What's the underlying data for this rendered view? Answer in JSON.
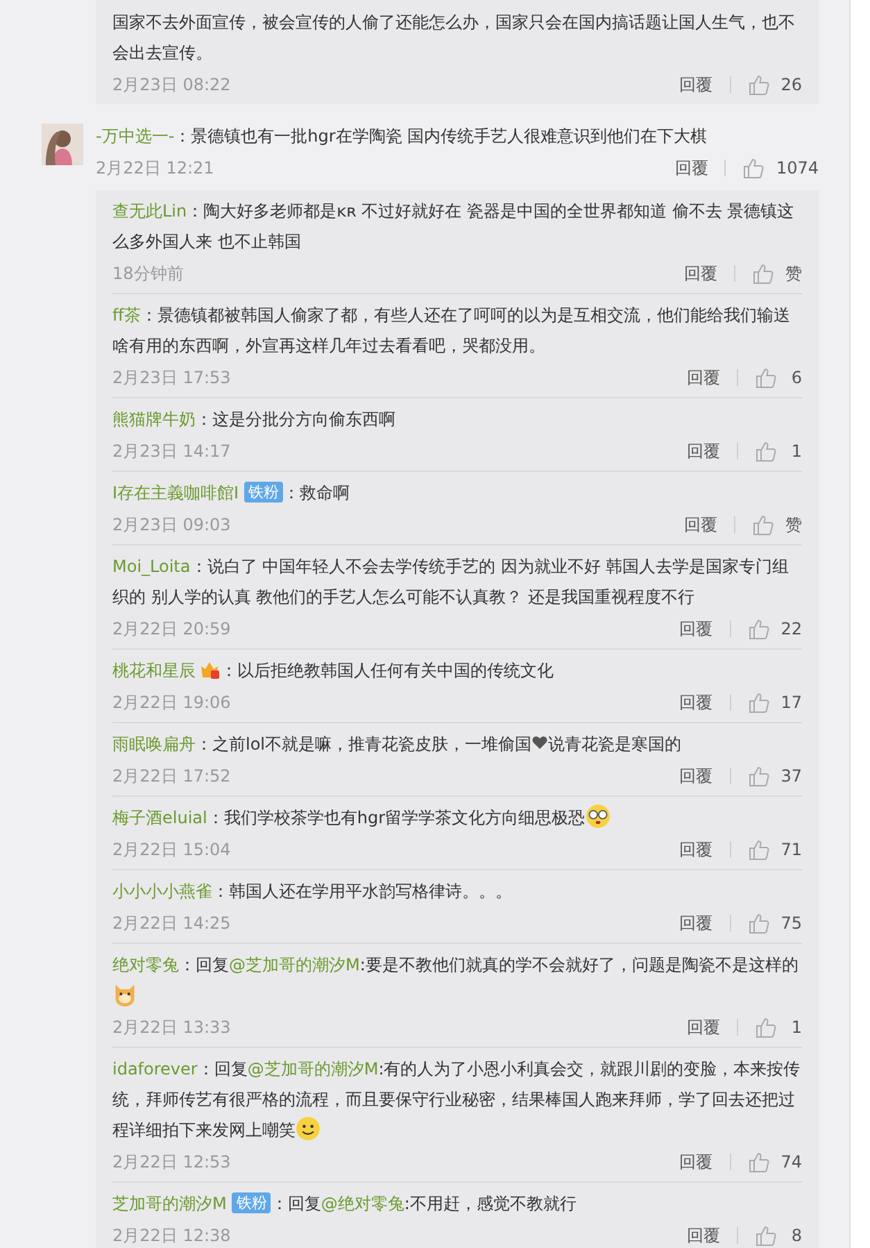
{
  "prev_reply": {
    "parts": [
      {
        "kind": "text",
        "text": "国家不去外面宣传，被会宣传的人偷了还能怎么办，国家只会在国内搞话题让国人生气，也不会出去宣传。"
      }
    ],
    "time": "2月23日 08:22",
    "reply_label": "回覆",
    "likes": "26"
  },
  "comment": {
    "user": "-万中选一-",
    "parts": [
      {
        "kind": "text",
        "text": "：景德镇也有一批hgr在学陶瓷 国内传统手艺人很难意识到他们在下大棋"
      }
    ],
    "time": "2月22日 12:21",
    "reply_label": "回覆",
    "likes": "1074",
    "replies": [
      {
        "user": "查无此Lin",
        "parts": [
          {
            "kind": "text",
            "text": "：陶大好多老师都是ᴋʀ 不过好就好在 瓷器是中国的全世界都知道 偷不去 景德镇这么多外国人来 也不止韩国"
          }
        ],
        "time": "18分钟前",
        "reply_label": "回覆",
        "likes": "赞"
      },
      {
        "user": "ff茶",
        "parts": [
          {
            "kind": "text",
            "text": "：景德镇都被韩国人偷家了都，有些人还在了呵呵的以为是互相交流，他们能给我们输送啥有用的东西啊，外宣再这样几年过去看看吧，哭都没用。"
          }
        ],
        "time": "2月23日 17:53",
        "reply_label": "回覆",
        "likes": "6"
      },
      {
        "user": "熊猫牌牛奶",
        "parts": [
          {
            "kind": "text",
            "text": "：这是分批分方向偷东西啊"
          }
        ],
        "time": "2月23日 14:17",
        "reply_label": "回覆",
        "likes": "1"
      },
      {
        "user": "I存在主義咖啡館I",
        "badge": "铁粉",
        "parts": [
          {
            "kind": "text",
            "text": "：救命啊"
          }
        ],
        "time": "2月23日 09:03",
        "reply_label": "回覆",
        "likes": "赞"
      },
      {
        "user": "Moi_Loita",
        "parts": [
          {
            "kind": "text",
            "text": "：说白了 中国年轻人不会去学传统手艺的 因为就业不好 韩国人去学是国家专门组织的 别人学的认真 教他们的手艺人怎么可能不认真教？ 还是我国重视程度不行"
          }
        ],
        "time": "2月22日 20:59",
        "reply_label": "回覆",
        "likes": "22"
      },
      {
        "user": "桃花和星辰",
        "member_icon": true,
        "parts": [
          {
            "kind": "text",
            "text": "：以后拒绝教韩国人任何有关中国的传统文化"
          }
        ],
        "time": "2月22日 19:06",
        "reply_label": "回覆",
        "likes": "17"
      },
      {
        "user": "雨眠唤扁舟",
        "parts": [
          {
            "kind": "text",
            "text": "：之前lol不就是嘛，推青花瓷皮肤，一堆偷国"
          },
          {
            "kind": "heart"
          },
          {
            "kind": "text",
            "text": "说青花瓷是寒国的"
          }
        ],
        "time": "2月22日 17:52",
        "reply_label": "回覆",
        "likes": "37"
      },
      {
        "user": "梅子酒eluial",
        "parts": [
          {
            "kind": "text",
            "text": "：我们学校茶学也有hgr留学学茶文化方向细思极恐"
          },
          {
            "kind": "goggles"
          }
        ],
        "time": "2月22日 15:04",
        "reply_label": "回覆",
        "likes": "71"
      },
      {
        "user": "小小小小燕雀",
        "parts": [
          {
            "kind": "text",
            "text": "：韩国人还在学用平水韵写格律诗。。。"
          }
        ],
        "time": "2月22日 14:25",
        "reply_label": "回覆",
        "likes": "75"
      },
      {
        "user": "绝对零兔",
        "parts": [
          {
            "kind": "text",
            "text": "：回复"
          },
          {
            "kind": "mention",
            "text": "@芝加哥的潮汐M"
          },
          {
            "kind": "text",
            "text": ":要是不教他们就真的学不会就好了，问题是陶瓷不是这样的"
          },
          {
            "kind": "dog"
          }
        ],
        "time": "2月22日 13:33",
        "reply_label": "回覆",
        "likes": "1"
      },
      {
        "user": "idaforever",
        "parts": [
          {
            "kind": "text",
            "text": "：回复"
          },
          {
            "kind": "mention",
            "text": "@芝加哥的潮汐M"
          },
          {
            "kind": "text",
            "text": ":有的人为了小恩小利真会交，就跟川剧的变脸，本来按传统，拜师传艺有很严格的流程，而且要保守行业秘密，结果棒国人跑来拜师，学了回去还把过程详细拍下来发网上嘲笑"
          },
          {
            "kind": "smiley"
          }
        ],
        "time": "2月22日 12:53",
        "reply_label": "回覆",
        "likes": "74"
      },
      {
        "user": "芝加哥的潮汐M",
        "badge": "铁粉",
        "parts": [
          {
            "kind": "text",
            "text": "：回复"
          },
          {
            "kind": "mention",
            "text": "@绝对零兔"
          },
          {
            "kind": "text",
            "text": ":不用赶，感觉不教就行"
          }
        ],
        "time": "2月22日 12:38",
        "reply_label": "回覆",
        "likes": "8"
      }
    ]
  }
}
